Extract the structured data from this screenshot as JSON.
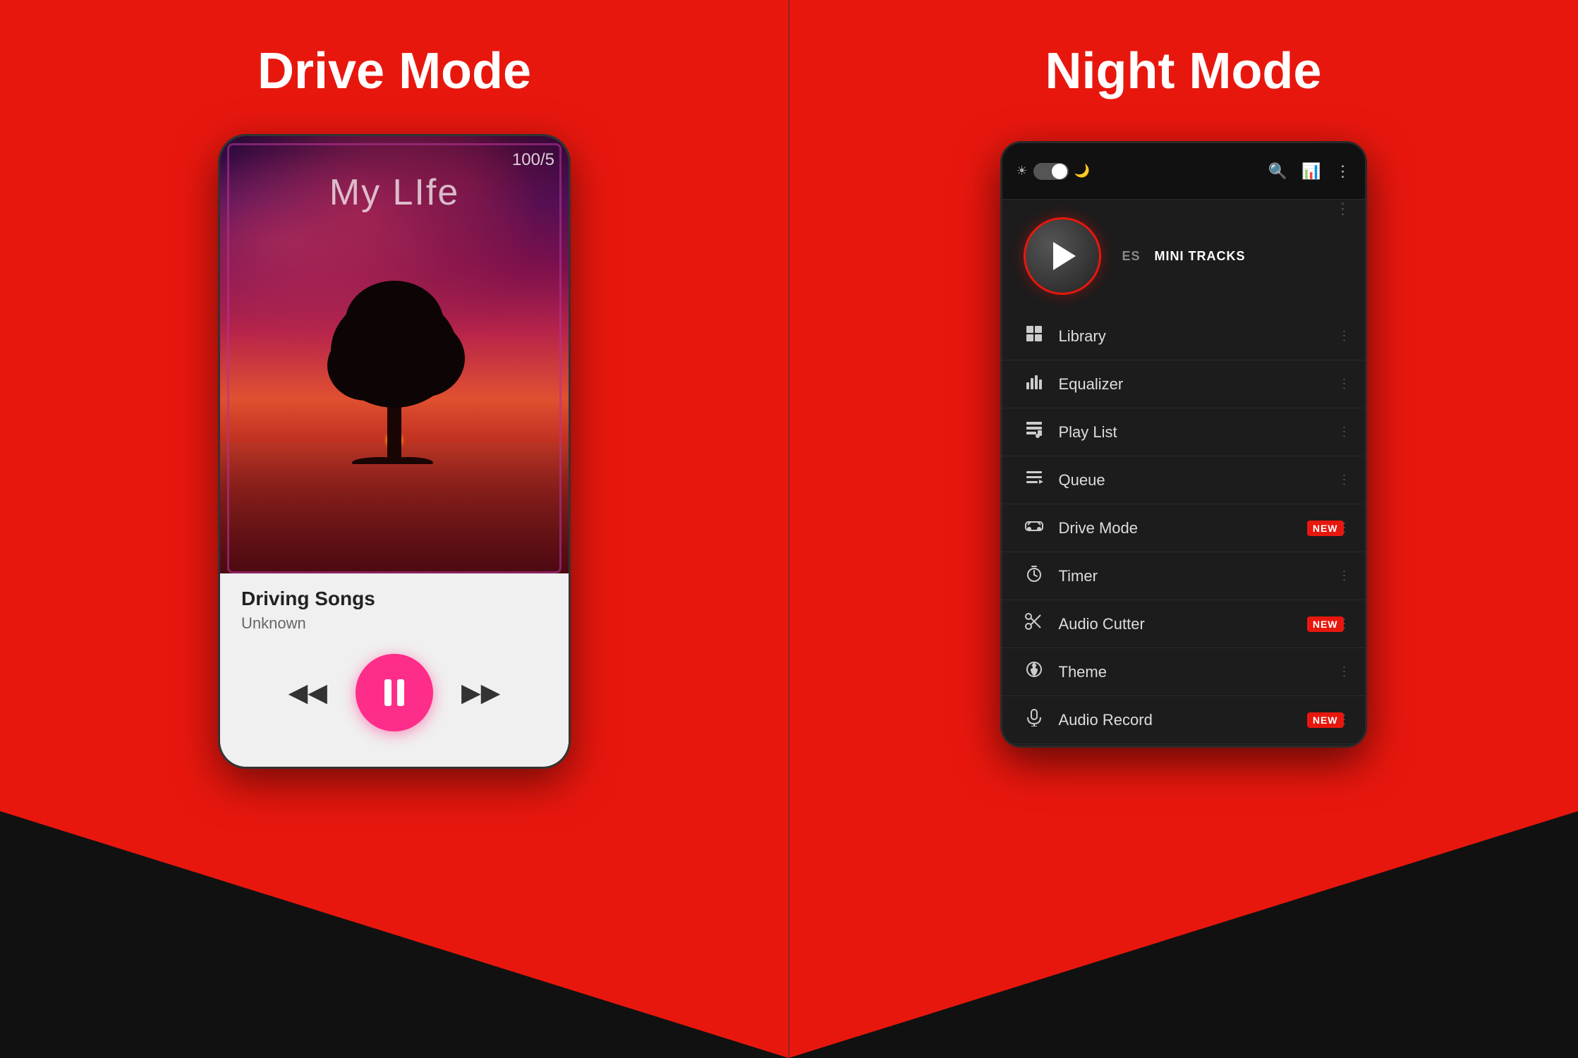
{
  "left": {
    "title": "Drive Mode",
    "background_color": "#e8170e",
    "phone": {
      "track_number": "100/5",
      "song_title": "My LIfe",
      "album_name": "Driving Songs",
      "artist": "Unknown",
      "controls": {
        "rewind": "⏮",
        "pause": "⏸",
        "forward": "⏭"
      }
    }
  },
  "right": {
    "title": "Night Mode",
    "background_color": "#e8170e",
    "phone": {
      "tabs": [
        "ES",
        "MINI TRACKS"
      ],
      "menu_items": [
        {
          "id": "library",
          "icon": "🎵",
          "label": "Library",
          "badge": null
        },
        {
          "id": "equalizer",
          "icon": "📊",
          "label": "Equalizer",
          "badge": null
        },
        {
          "id": "playlist",
          "icon": "📋",
          "label": "Play List",
          "badge": null
        },
        {
          "id": "queue",
          "icon": "☰",
          "label": "Queue",
          "badge": null
        },
        {
          "id": "drive-mode",
          "icon": "🚗",
          "label": "Drive Mode",
          "badge": "NEW"
        },
        {
          "id": "timer",
          "icon": "⏱",
          "label": "Timer",
          "badge": null
        },
        {
          "id": "audio-cutter",
          "icon": "✂",
          "label": "Audio Cutter",
          "badge": "NEW"
        },
        {
          "id": "theme",
          "icon": "🎨",
          "label": "Theme",
          "badge": null
        },
        {
          "id": "audio-record",
          "icon": "🎤",
          "label": "Audio Record",
          "badge": "NEW"
        }
      ]
    }
  }
}
